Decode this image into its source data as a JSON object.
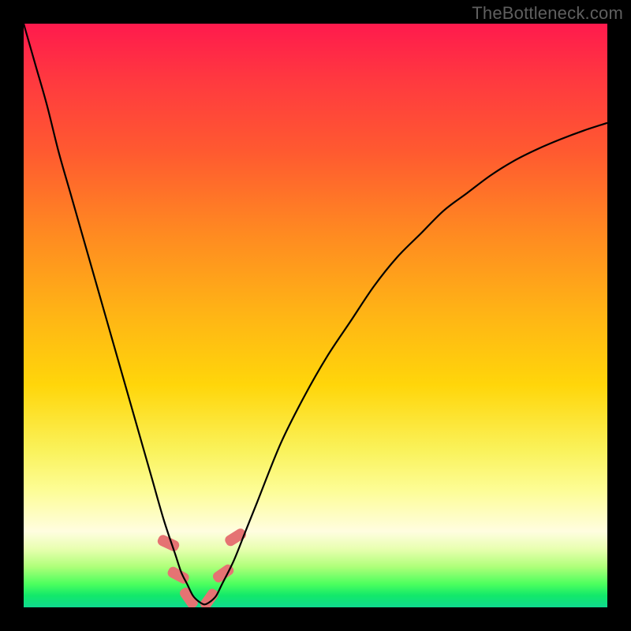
{
  "watermark": "TheBottleneck.com",
  "chart_data": {
    "type": "line",
    "title": "",
    "xlabel": "",
    "ylabel": "",
    "xlim": [
      0,
      100
    ],
    "ylim": [
      0,
      100
    ],
    "grid": false,
    "series": [
      {
        "name": "curve",
        "x": [
          0,
          2,
          4,
          6,
          8,
          10,
          12,
          14,
          16,
          18,
          20,
          22,
          24,
          26,
          27,
          28,
          29,
          30,
          31,
          32,
          33,
          34,
          36,
          38,
          40,
          44,
          48,
          52,
          56,
          60,
          64,
          68,
          72,
          76,
          80,
          84,
          88,
          92,
          96,
          100
        ],
        "y": [
          100,
          93,
          86,
          78,
          71,
          64,
          57,
          50,
          43,
          36,
          29,
          22,
          15,
          9,
          6,
          4,
          2,
          1,
          0.5,
          1,
          2,
          4,
          8,
          13,
          18,
          28,
          36,
          43,
          49,
          55,
          60,
          64,
          68,
          71,
          74,
          76.5,
          78.5,
          80.2,
          81.7,
          83
        ],
        "color": "#000000"
      }
    ],
    "markers": [
      {
        "x": 24.8,
        "y": 11.0,
        "rot": -65
      },
      {
        "x": 26.5,
        "y": 5.5,
        "rot": -62
      },
      {
        "x": 28.3,
        "y": 1.6,
        "rot": -35
      },
      {
        "x": 31.8,
        "y": 1.4,
        "rot": 35
      },
      {
        "x": 34.2,
        "y": 5.8,
        "rot": 55
      },
      {
        "x": 36.3,
        "y": 12.0,
        "rot": 58
      }
    ],
    "marker_style": {
      "fill": "#e57373",
      "rx": 6,
      "w": 14,
      "h": 28
    }
  }
}
